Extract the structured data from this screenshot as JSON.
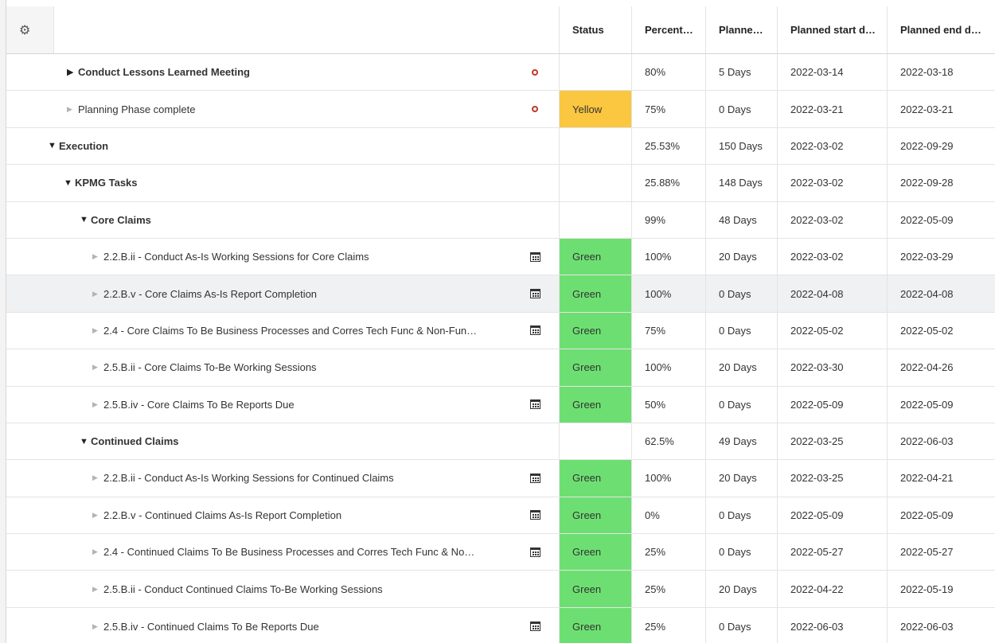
{
  "header": {
    "status": "Status",
    "percent": "Percent…",
    "duration": "Planne…",
    "start": "Planned start d…",
    "end": "Planned end d…"
  },
  "rows": [
    {
      "name": "Conduct Lessons Learned Meeting",
      "status": "",
      "percent": "80%",
      "duration": "5 Days",
      "start": "2022-03-14",
      "end": "2022-03-18"
    },
    {
      "name": "Planning Phase complete",
      "status": "Yellow",
      "percent": "75%",
      "duration": "0 Days",
      "start": "2022-03-21",
      "end": "2022-03-21"
    },
    {
      "name": "Execution",
      "status": "",
      "percent": "25.53%",
      "duration": "150 Days",
      "start": "2022-03-02",
      "end": "2022-09-29"
    },
    {
      "name": "KPMG Tasks",
      "status": "",
      "percent": "25.88%",
      "duration": "148 Days",
      "start": "2022-03-02",
      "end": "2022-09-28"
    },
    {
      "name": "Core Claims",
      "status": "",
      "percent": "99%",
      "duration": "48 Days",
      "start": "2022-03-02",
      "end": "2022-05-09"
    },
    {
      "name": "2.2.B.ii - Conduct As-Is Working Sessions for Core Claims",
      "status": "Green",
      "percent": "100%",
      "duration": "20 Days",
      "start": "2022-03-02",
      "end": "2022-03-29"
    },
    {
      "name": "2.2.B.v - Core Claims As-Is Report Completion",
      "status": "Green",
      "percent": "100%",
      "duration": "0 Days",
      "start": "2022-04-08",
      "end": "2022-04-08"
    },
    {
      "name": "2.4 - Core Claims To Be Business Processes and Corres Tech Func & Non-Fun…",
      "status": "Green",
      "percent": "75%",
      "duration": "0 Days",
      "start": "2022-05-02",
      "end": "2022-05-02"
    },
    {
      "name": "2.5.B.ii - Core Claims To-Be Working Sessions",
      "status": "Green",
      "percent": "100%",
      "duration": "20 Days",
      "start": "2022-03-30",
      "end": "2022-04-26"
    },
    {
      "name": "2.5.B.iv - Core Claims To Be Reports Due",
      "status": "Green",
      "percent": "50%",
      "duration": "0 Days",
      "start": "2022-05-09",
      "end": "2022-05-09"
    },
    {
      "name": "Continued Claims",
      "status": "",
      "percent": "62.5%",
      "duration": "49 Days",
      "start": "2022-03-25",
      "end": "2022-06-03"
    },
    {
      "name": "2.2.B.ii - Conduct As-Is Working Sessions for Continued Claims",
      "status": "Green",
      "percent": "100%",
      "duration": "20 Days",
      "start": "2022-03-25",
      "end": "2022-04-21"
    },
    {
      "name": "2.2.B.v - Continued Claims As-Is Report Completion",
      "status": "Green",
      "percent": "0%",
      "duration": "0 Days",
      "start": "2022-05-09",
      "end": "2022-05-09"
    },
    {
      "name": "2.4 - Continued Claims To Be Business Processes and Corres Tech Func & No…",
      "status": "Green",
      "percent": "25%",
      "duration": "0 Days",
      "start": "2022-05-27",
      "end": "2022-05-27"
    },
    {
      "name": "2.5.B.ii - Conduct Continued Claims To-Be Working Sessions",
      "status": "Green",
      "percent": "25%",
      "duration": "20 Days",
      "start": "2022-04-22",
      "end": "2022-05-19"
    },
    {
      "name": "2.5.B.iv - Continued Claims To Be Reports Due",
      "status": "Green",
      "percent": "25%",
      "duration": "0 Days",
      "start": "2022-06-03",
      "end": "2022-06-03"
    }
  ]
}
